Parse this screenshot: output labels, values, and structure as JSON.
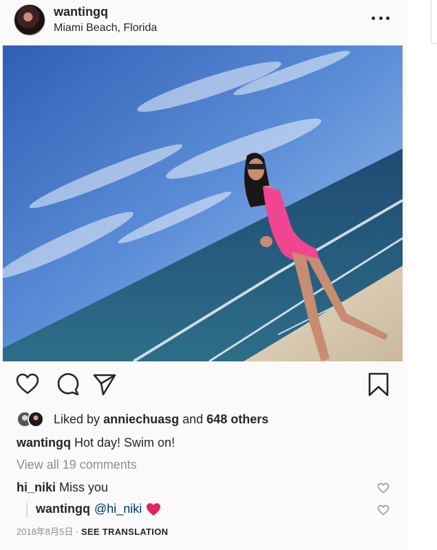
{
  "post": {
    "username": "wantingq",
    "location": "Miami Beach, Florida"
  },
  "likes": {
    "prefix": "Liked by",
    "liker": "anniechuasg",
    "connector": "and",
    "others": "648 others"
  },
  "caption": {
    "username": "wantingq",
    "text": "Hot day! Swim on!"
  },
  "view_all_comments": "View all 19 comments",
  "comments": [
    {
      "username": "hi_niki",
      "text": "Miss you"
    }
  ],
  "reply": {
    "username": "wantingq",
    "mention": "@hi_niki"
  },
  "date": "2018年8月5日",
  "date_separator": "·",
  "see_translation": "SEE TRANSLATION",
  "colors": {
    "text": "#262626",
    "muted": "#8e8e8e",
    "mention": "#003569",
    "heart_emoji": "#e0245e",
    "swimsuit": "#f0458f"
  },
  "icons": [
    "more-icon",
    "heart-icon",
    "comment-icon",
    "share-icon",
    "bookmark-icon",
    "small-heart-icon",
    "red-heart-emoji"
  ]
}
